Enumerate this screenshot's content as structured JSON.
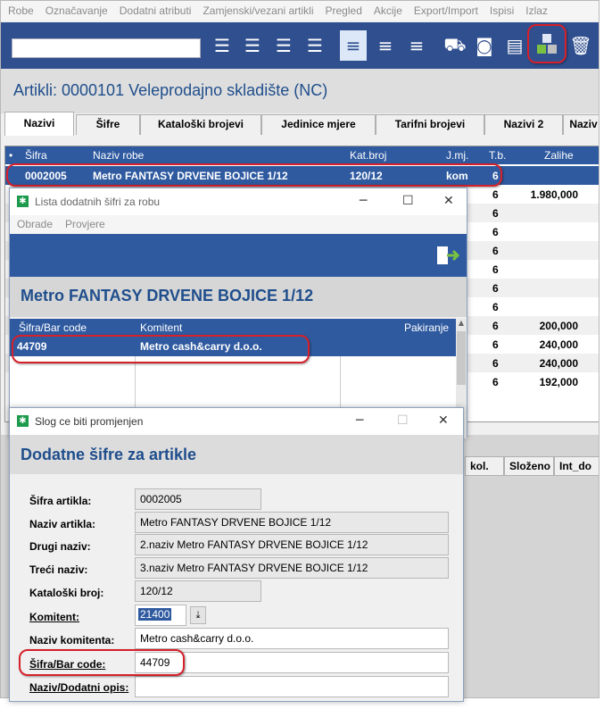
{
  "menu": [
    "Robe",
    "Označavanje",
    "Dodatni atributi",
    "Zamjenski/vezani artikli",
    "Pregled",
    "Akcije",
    "Export/Import",
    "Ispisi",
    "Izlaz"
  ],
  "toolbar": {
    "search_value": "",
    "icons": [
      "list-export-icon",
      "list-arrow-icon",
      "list-delete-icon",
      "list-refresh-icon",
      "lines-icon",
      "lines-icon",
      "lines-icon",
      "hand-truck-icon",
      "camera-icon",
      "document-icon",
      "blocks-icon",
      "trash-icon"
    ]
  },
  "page_title": "Artikli: 0000101 Veleprodajno skladište (NC)",
  "tabs": [
    "Nazivi",
    "Šifre",
    "Kataloški brojevi",
    "Jedinice mjere",
    "Tarifni brojevi",
    "Nazivi 2",
    "Naziv"
  ],
  "grid": {
    "columns": [
      "Šifra",
      "Naziv robe",
      "Kat.broj",
      "J.mj.",
      "T.b.",
      "Zalihe"
    ],
    "rows": [
      {
        "sifra": "0002005",
        "naziv": "Metro FANTASY DRVENE BOJICE 1/12",
        "kat": "120/12",
        "jmj": "kom",
        "tb": "6",
        "zalihe": ""
      },
      {
        "sifra": "",
        "naziv": "",
        "kat": "",
        "jmj": "",
        "tb": "6",
        "zalihe": "1.980,000"
      },
      {
        "sifra": "",
        "naziv": "",
        "kat": "",
        "jmj": "",
        "tb": "6",
        "zalihe": ""
      },
      {
        "sifra": "",
        "naziv": "",
        "kat": "",
        "jmj": "",
        "tb": "6",
        "zalihe": ""
      },
      {
        "sifra": "",
        "naziv": "",
        "kat": "",
        "jmj": "",
        "tb": "6",
        "zalihe": ""
      },
      {
        "sifra": "",
        "naziv": "",
        "kat": "",
        "jmj": "",
        "tb": "6",
        "zalihe": ""
      },
      {
        "sifra": "",
        "naziv": "",
        "kat": "",
        "jmj": "",
        "tb": "6",
        "zalihe": ""
      },
      {
        "sifra": "",
        "naziv": "",
        "kat": "",
        "jmj": "",
        "tb": "6",
        "zalihe": ""
      },
      {
        "sifra": "",
        "naziv": "",
        "kat": "",
        "jmj": "",
        "tb": "6",
        "zalihe": "200,000"
      },
      {
        "sifra": "",
        "naziv": "",
        "kat": "",
        "jmj": "",
        "tb": "6",
        "zalihe": "240,000"
      },
      {
        "sifra": "",
        "naziv": "",
        "kat": "",
        "jmj": "",
        "tb": "6",
        "zalihe": "240,000"
      },
      {
        "sifra": "",
        "naziv": "",
        "kat": "",
        "jmj": "",
        "tb": "6",
        "zalihe": "192,000"
      }
    ]
  },
  "bottom_tabs": [
    "kol.",
    "Složeno",
    "Int_do"
  ],
  "dialog1": {
    "title": "Lista dodatnih šifri za robu",
    "menu": [
      "Obrade",
      "Provjere"
    ],
    "heading": "Metro FANTASY DRVENE BOJICE 1/12",
    "columns": [
      "Šifra/Bar code",
      "Komitent",
      "Pakiranje"
    ],
    "rows": [
      {
        "sifra": "44709",
        "komitent": "Metro cash&carry d.o.o.",
        "pakiranje": ""
      }
    ]
  },
  "dialog2": {
    "title": "Slog ce biti promjenjen",
    "heading": "Dodatne šifre za artikle",
    "fields": {
      "sifra_artikla": {
        "label": "Šifra artikla:",
        "value": "0002005"
      },
      "naziv_artikla": {
        "label": "Naziv artikla:",
        "value": "Metro FANTASY DRVENE BOJICE 1/12"
      },
      "drugi_naziv": {
        "label": "Drugi naziv:",
        "value": "2.naziv Metro FANTASY DRVENE BOJICE 1/12"
      },
      "treci_naziv": {
        "label": "Treći naziv:",
        "value": "3.naziv Metro FANTASY DRVENE BOJICE 1/12"
      },
      "katalogski_broj": {
        "label": "Kataloški broj:",
        "value": "120/12"
      },
      "komitent": {
        "label": "Komitent:",
        "value": "21400"
      },
      "naziv_komitenta": {
        "label": "Naziv komitenta:",
        "value": "Metro cash&carry d.o.o."
      },
      "bar_code": {
        "label": "Šifra/Bar code:",
        "value": "44709"
      },
      "dodatni_opis": {
        "label": "Naziv/Dodatni opis:",
        "value": ""
      }
    }
  },
  "colors": {
    "accent": "#2f5aa0",
    "toolbar": "#2f4f8f",
    "title": "#1f4e8c",
    "highlight": "#d6202a"
  }
}
